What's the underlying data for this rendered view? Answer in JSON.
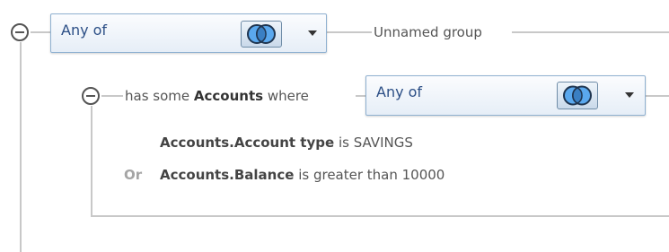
{
  "root_group": {
    "combo_value": "Any of",
    "combo_icon": "venn-intersection-icon",
    "name_placeholder": "Unnamed group"
  },
  "subquery": {
    "prefix": "has some",
    "entity": "Accounts",
    "suffix": "where",
    "combo_value": "Any of",
    "combo_icon": "venn-intersection-icon"
  },
  "conditions": [
    {
      "connector": "",
      "field": "Accounts.Account type",
      "operator_text": "is SAVINGS"
    },
    {
      "connector": "Or",
      "field": "Accounts.Balance",
      "operator_text": "is greater than 10000"
    }
  ],
  "colors": {
    "combo_text": "#2c4f86",
    "combo_border": "#8fb1d1",
    "connector_line": "#c8c8c8",
    "venn_fill": "#5aa8ee",
    "or_label": "#a5a5a5"
  }
}
